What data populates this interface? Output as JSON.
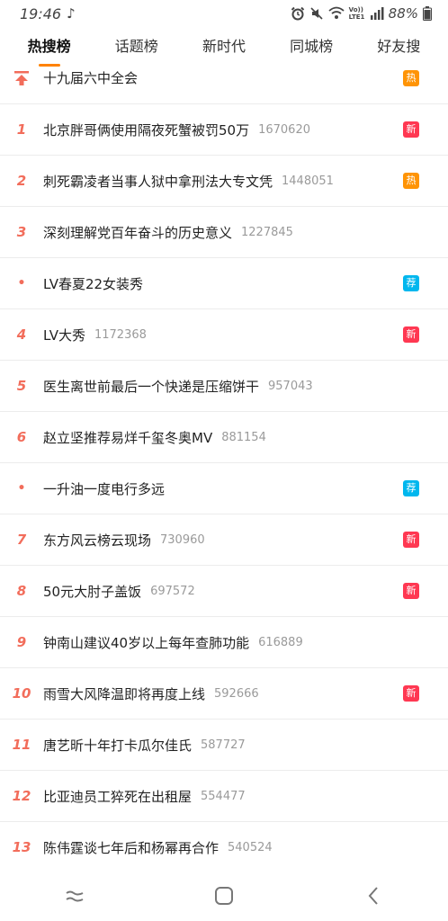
{
  "status": {
    "time": "19:46",
    "battery": "88%",
    "network_label": "Vo)) LTE1"
  },
  "tabs": [
    {
      "label": "热搜榜",
      "active": true
    },
    {
      "label": "话题榜",
      "active": false
    },
    {
      "label": "新时代",
      "active": false
    },
    {
      "label": "同城榜",
      "active": false
    },
    {
      "label": "好友搜",
      "active": false
    }
  ],
  "tag_colors": {
    "热": "#ff9406",
    "新": "#ff3852",
    "荐": "#00b7ee"
  },
  "rows": [
    {
      "rank": "",
      "type": "top",
      "title": "十九届六中全会",
      "count": "",
      "tag": "热"
    },
    {
      "rank": "1",
      "title": "北京胖哥俩使用隔夜死蟹被罚50万",
      "count": "1670620",
      "tag": "新"
    },
    {
      "rank": "2",
      "title": "刺死霸凌者当事人狱中拿刑法大专文凭",
      "count": "1448051",
      "tag": "热"
    },
    {
      "rank": "3",
      "title": "深刻理解党百年奋斗的历史意义",
      "count": "1227845",
      "tag": ""
    },
    {
      "rank": "•",
      "type": "dot",
      "title": "LV春夏22女装秀",
      "count": "",
      "tag": "荐"
    },
    {
      "rank": "4",
      "title": "LV大秀",
      "count": "1172368",
      "tag": "新"
    },
    {
      "rank": "5",
      "title": "医生离世前最后一个快递是压缩饼干",
      "count": "957043",
      "tag": ""
    },
    {
      "rank": "6",
      "title": "赵立坚推荐易烊千玺冬奥MV",
      "count": "881154",
      "tag": ""
    },
    {
      "rank": "•",
      "type": "dot",
      "title": "一升油一度电行多远",
      "count": "",
      "tag": "荐"
    },
    {
      "rank": "7",
      "title": "东方风云榜云现场",
      "count": "730960",
      "tag": "新"
    },
    {
      "rank": "8",
      "title": "50元大肘子盖饭",
      "count": "697572",
      "tag": "新"
    },
    {
      "rank": "9",
      "title": "钟南山建议40岁以上每年查肺功能",
      "count": "616889",
      "tag": ""
    },
    {
      "rank": "10",
      "title": "雨雪大风降温即将再度上线",
      "count": "592666",
      "tag": "新"
    },
    {
      "rank": "11",
      "title": "唐艺昕十年打卡瓜尔佳氏",
      "count": "587727",
      "tag": ""
    },
    {
      "rank": "12",
      "title": "比亚迪员工猝死在出租屋",
      "count": "554477",
      "tag": ""
    },
    {
      "rank": "13",
      "title": "陈伟霆谈七年后和杨幂再合作",
      "count": "540524",
      "tag": ""
    }
  ],
  "nav": {
    "recent_icon": "recent-apps-icon",
    "home_icon": "home-icon",
    "back_icon": "back-icon"
  }
}
